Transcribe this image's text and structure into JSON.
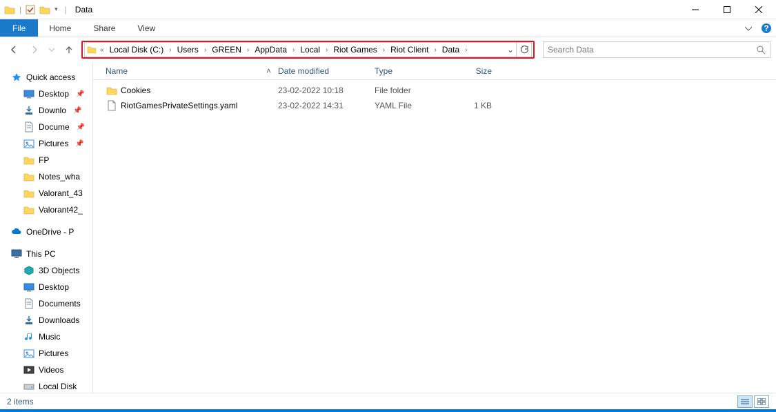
{
  "window": {
    "title": "Data"
  },
  "ribbon": {
    "file": "File",
    "tabs": [
      "Home",
      "Share",
      "View"
    ]
  },
  "breadcrumb": [
    "Local Disk (C:)",
    "Users",
    "GREEN",
    "AppData",
    "Local",
    "Riot Games",
    "Riot Client",
    "Data"
  ],
  "search": {
    "placeholder": "Search Data"
  },
  "columns": {
    "name": "Name",
    "date": "Date modified",
    "type": "Type",
    "size": "Size"
  },
  "rows": [
    {
      "icon": "folder",
      "name": "Cookies",
      "date": "23-02-2022 10:18",
      "type": "File folder",
      "size": ""
    },
    {
      "icon": "file",
      "name": "RiotGamesPrivateSettings.yaml",
      "date": "23-02-2022 14:31",
      "type": "YAML File",
      "size": "1 KB"
    }
  ],
  "sidebar": {
    "quick": {
      "label": "Quick access",
      "items": [
        {
          "label": "Desktop",
          "icon": "desktop",
          "pin": true
        },
        {
          "label": "Downlo",
          "icon": "downloads",
          "pin": true
        },
        {
          "label": "Docume",
          "icon": "documents",
          "pin": true
        },
        {
          "label": "Pictures",
          "icon": "pictures",
          "pin": true
        },
        {
          "label": "FP",
          "icon": "folder"
        },
        {
          "label": "Notes_wha",
          "icon": "folder"
        },
        {
          "label": "Valorant_43",
          "icon": "folder"
        },
        {
          "label": "Valorant42_",
          "icon": "folder"
        }
      ]
    },
    "onedrive": {
      "label": "OneDrive - P"
    },
    "thispc": {
      "label": "This PC",
      "items": [
        {
          "label": "3D Objects",
          "icon": "3d"
        },
        {
          "label": "Desktop",
          "icon": "desktop"
        },
        {
          "label": "Documents",
          "icon": "documents"
        },
        {
          "label": "Downloads",
          "icon": "downloads"
        },
        {
          "label": "Music",
          "icon": "music"
        },
        {
          "label": "Pictures",
          "icon": "pictures"
        },
        {
          "label": "Videos",
          "icon": "videos"
        },
        {
          "label": "Local Disk",
          "icon": "drive"
        }
      ]
    }
  },
  "status": {
    "text": "2 items"
  }
}
